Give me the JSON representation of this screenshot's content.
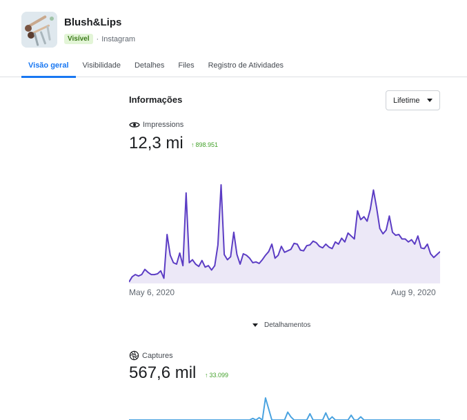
{
  "header": {
    "page_name": "Blush&Lips",
    "status_badge": "Visível",
    "platform": "Instagram"
  },
  "tabs": [
    {
      "label": "Visão geral",
      "active": true
    },
    {
      "label": "Visibilidade",
      "active": false
    },
    {
      "label": "Detalhes",
      "active": false
    },
    {
      "label": "Files",
      "active": false
    },
    {
      "label": "Registro de Atividades",
      "active": false
    }
  ],
  "insights": {
    "title": "Informações",
    "range_select": "Lifetime"
  },
  "impressions": {
    "label": "Impressions",
    "value": "12,3 mi",
    "delta": "898.951",
    "icon": "eye-icon"
  },
  "captures": {
    "label": "Captures",
    "value": "567,6 mil",
    "delta": "33.099",
    "icon": "aperture-icon"
  },
  "breakdown_label": "Detalhamentos",
  "colors": {
    "accent": "#1877f2",
    "line": "#5b3cc4",
    "area": "#ece8f7",
    "positive": "#42a12a",
    "captures_line": "#4aa3e0"
  },
  "chart_data": {
    "type": "area",
    "x_start": "May 6, 2020",
    "x_end": "Aug 9, 2020",
    "grid": false,
    "values": [
      2,
      9,
      12,
      10,
      12,
      19,
      15,
      12,
      12,
      13,
      17,
      7,
      66,
      38,
      28,
      26,
      41,
      24,
      122,
      28,
      32,
      26,
      23,
      31,
      22,
      24,
      18,
      24,
      52,
      133,
      39,
      32,
      36,
      69,
      39,
      26,
      40,
      38,
      34,
      28,
      29,
      27,
      32,
      38,
      43,
      53,
      34,
      38,
      50,
      42,
      44,
      46,
      54,
      53,
      45,
      44,
      51,
      52,
      57,
      55,
      50,
      48,
      53,
      49,
      47,
      56,
      53,
      61,
      56,
      68,
      64,
      60,
      98,
      86,
      90,
      84,
      100,
      126,
      102,
      74,
      67,
      72,
      91,
      69,
      65,
      66,
      60,
      60,
      56,
      59,
      53,
      64,
      48,
      47,
      53,
      40,
      35,
      39,
      43
    ]
  },
  "chart2_data": {
    "type": "line",
    "values": [
      0,
      0,
      0,
      0,
      0,
      0,
      0,
      0,
      0,
      0,
      0,
      0,
      0,
      0,
      0,
      0,
      0,
      0,
      0,
      0,
      0,
      0,
      0,
      0,
      0,
      0,
      0,
      0,
      0,
      0,
      0,
      0,
      0,
      0,
      0,
      0,
      0,
      0,
      0,
      2,
      0,
      3,
      0,
      28,
      14,
      0,
      0,
      0,
      0,
      0,
      10,
      4,
      0,
      0,
      0,
      0,
      0,
      8,
      0,
      0,
      0,
      0,
      9,
      0,
      4,
      0,
      0,
      0,
      0,
      0,
      6,
      0,
      0,
      4,
      0,
      0,
      0,
      0,
      0,
      0,
      0,
      0,
      0,
      0,
      0,
      0,
      0,
      0,
      0,
      0,
      0,
      0,
      0,
      0,
      0,
      0,
      0,
      0,
      0
    ]
  }
}
